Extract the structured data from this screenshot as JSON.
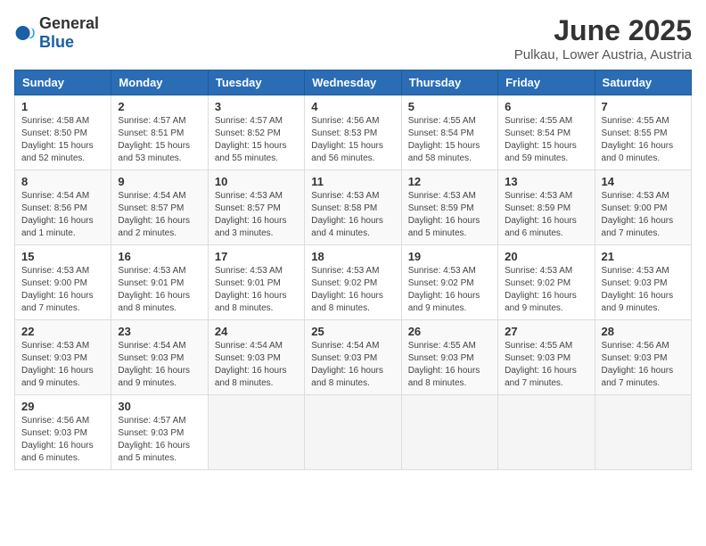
{
  "logo": {
    "general": "General",
    "blue": "Blue"
  },
  "title": "June 2025",
  "location": "Pulkau, Lower Austria, Austria",
  "weekdays": [
    "Sunday",
    "Monday",
    "Tuesday",
    "Wednesday",
    "Thursday",
    "Friday",
    "Saturday"
  ],
  "weeks": [
    [
      {
        "day": "1",
        "info": "Sunrise: 4:58 AM\nSunset: 8:50 PM\nDaylight: 15 hours\nand 52 minutes."
      },
      {
        "day": "2",
        "info": "Sunrise: 4:57 AM\nSunset: 8:51 PM\nDaylight: 15 hours\nand 53 minutes."
      },
      {
        "day": "3",
        "info": "Sunrise: 4:57 AM\nSunset: 8:52 PM\nDaylight: 15 hours\nand 55 minutes."
      },
      {
        "day": "4",
        "info": "Sunrise: 4:56 AM\nSunset: 8:53 PM\nDaylight: 15 hours\nand 56 minutes."
      },
      {
        "day": "5",
        "info": "Sunrise: 4:55 AM\nSunset: 8:54 PM\nDaylight: 15 hours\nand 58 minutes."
      },
      {
        "day": "6",
        "info": "Sunrise: 4:55 AM\nSunset: 8:54 PM\nDaylight: 15 hours\nand 59 minutes."
      },
      {
        "day": "7",
        "info": "Sunrise: 4:55 AM\nSunset: 8:55 PM\nDaylight: 16 hours\nand 0 minutes."
      }
    ],
    [
      {
        "day": "8",
        "info": "Sunrise: 4:54 AM\nSunset: 8:56 PM\nDaylight: 16 hours\nand 1 minute."
      },
      {
        "day": "9",
        "info": "Sunrise: 4:54 AM\nSunset: 8:57 PM\nDaylight: 16 hours\nand 2 minutes."
      },
      {
        "day": "10",
        "info": "Sunrise: 4:53 AM\nSunset: 8:57 PM\nDaylight: 16 hours\nand 3 minutes."
      },
      {
        "day": "11",
        "info": "Sunrise: 4:53 AM\nSunset: 8:58 PM\nDaylight: 16 hours\nand 4 minutes."
      },
      {
        "day": "12",
        "info": "Sunrise: 4:53 AM\nSunset: 8:59 PM\nDaylight: 16 hours\nand 5 minutes."
      },
      {
        "day": "13",
        "info": "Sunrise: 4:53 AM\nSunset: 8:59 PM\nDaylight: 16 hours\nand 6 minutes."
      },
      {
        "day": "14",
        "info": "Sunrise: 4:53 AM\nSunset: 9:00 PM\nDaylight: 16 hours\nand 7 minutes."
      }
    ],
    [
      {
        "day": "15",
        "info": "Sunrise: 4:53 AM\nSunset: 9:00 PM\nDaylight: 16 hours\nand 7 minutes."
      },
      {
        "day": "16",
        "info": "Sunrise: 4:53 AM\nSunset: 9:01 PM\nDaylight: 16 hours\nand 8 minutes."
      },
      {
        "day": "17",
        "info": "Sunrise: 4:53 AM\nSunset: 9:01 PM\nDaylight: 16 hours\nand 8 minutes."
      },
      {
        "day": "18",
        "info": "Sunrise: 4:53 AM\nSunset: 9:02 PM\nDaylight: 16 hours\nand 8 minutes."
      },
      {
        "day": "19",
        "info": "Sunrise: 4:53 AM\nSunset: 9:02 PM\nDaylight: 16 hours\nand 9 minutes."
      },
      {
        "day": "20",
        "info": "Sunrise: 4:53 AM\nSunset: 9:02 PM\nDaylight: 16 hours\nand 9 minutes."
      },
      {
        "day": "21",
        "info": "Sunrise: 4:53 AM\nSunset: 9:03 PM\nDaylight: 16 hours\nand 9 minutes."
      }
    ],
    [
      {
        "day": "22",
        "info": "Sunrise: 4:53 AM\nSunset: 9:03 PM\nDaylight: 16 hours\nand 9 minutes."
      },
      {
        "day": "23",
        "info": "Sunrise: 4:54 AM\nSunset: 9:03 PM\nDaylight: 16 hours\nand 9 minutes."
      },
      {
        "day": "24",
        "info": "Sunrise: 4:54 AM\nSunset: 9:03 PM\nDaylight: 16 hours\nand 8 minutes."
      },
      {
        "day": "25",
        "info": "Sunrise: 4:54 AM\nSunset: 9:03 PM\nDaylight: 16 hours\nand 8 minutes."
      },
      {
        "day": "26",
        "info": "Sunrise: 4:55 AM\nSunset: 9:03 PM\nDaylight: 16 hours\nand 8 minutes."
      },
      {
        "day": "27",
        "info": "Sunrise: 4:55 AM\nSunset: 9:03 PM\nDaylight: 16 hours\nand 7 minutes."
      },
      {
        "day": "28",
        "info": "Sunrise: 4:56 AM\nSunset: 9:03 PM\nDaylight: 16 hours\nand 7 minutes."
      }
    ],
    [
      {
        "day": "29",
        "info": "Sunrise: 4:56 AM\nSunset: 9:03 PM\nDaylight: 16 hours\nand 6 minutes."
      },
      {
        "day": "30",
        "info": "Sunrise: 4:57 AM\nSunset: 9:03 PM\nDaylight: 16 hours\nand 5 minutes."
      },
      {
        "day": "",
        "info": ""
      },
      {
        "day": "",
        "info": ""
      },
      {
        "day": "",
        "info": ""
      },
      {
        "day": "",
        "info": ""
      },
      {
        "day": "",
        "info": ""
      }
    ]
  ]
}
